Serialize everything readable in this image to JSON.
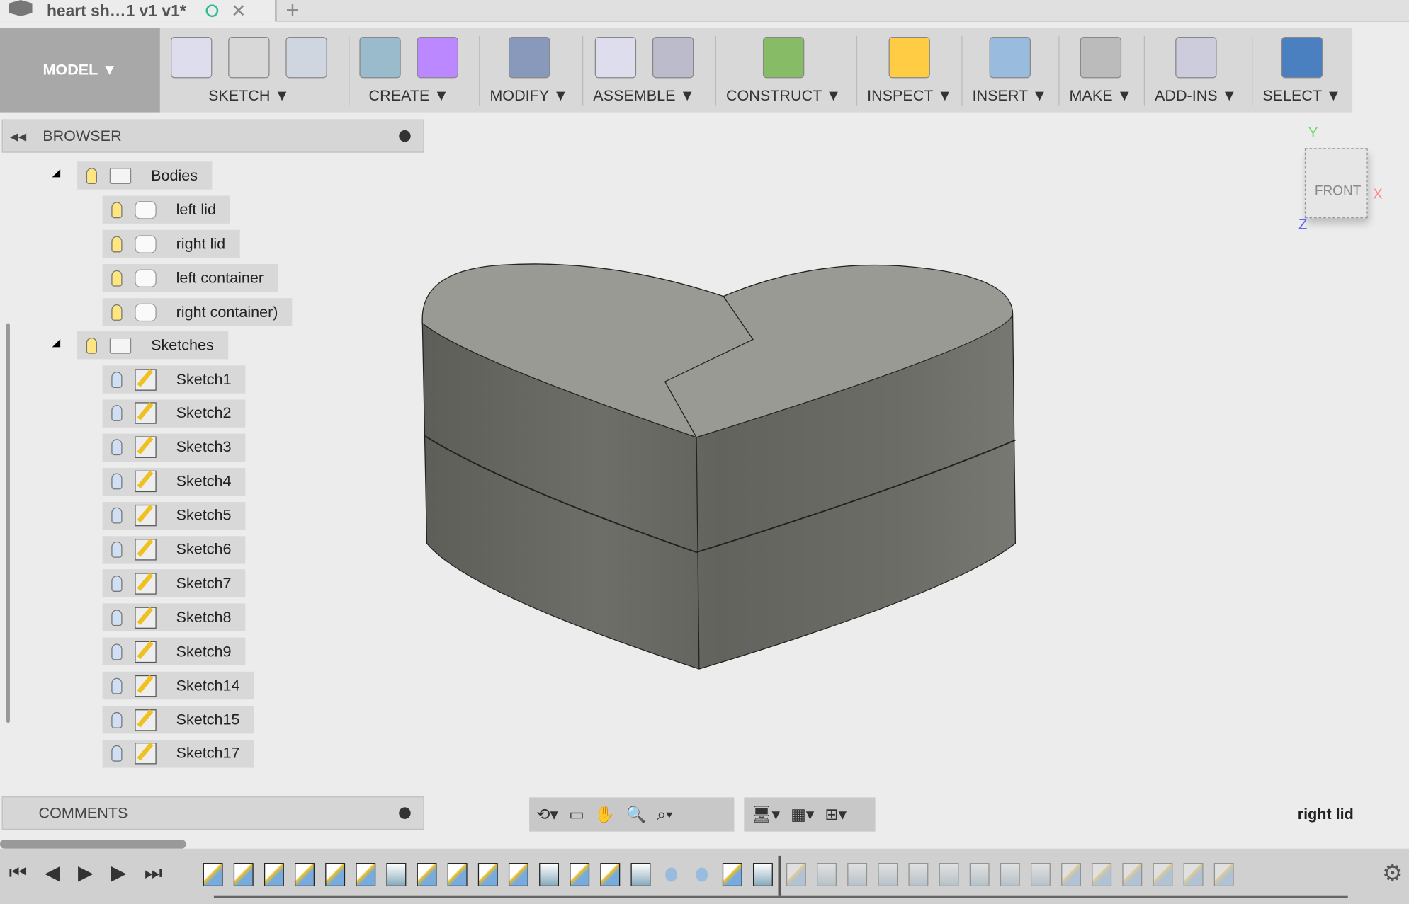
{
  "tab": {
    "title": "heart sh…1 v1 v1*",
    "close": "✕",
    "new": "+"
  },
  "toolbar": {
    "workspace": "MODEL ▼",
    "groups": [
      {
        "label": "SKETCH ▼",
        "icons": [
          "create-sketch-icon",
          "arc-icon",
          "rectangle-icon"
        ]
      },
      {
        "label": "CREATE ▼",
        "icons": [
          "extrude-icon",
          "form-icon"
        ]
      },
      {
        "label": "MODIFY ▼",
        "icons": [
          "press-pull-icon"
        ]
      },
      {
        "label": "ASSEMBLE ▼",
        "icons": [
          "new-component-icon",
          "joint-icon"
        ]
      },
      {
        "label": "CONSTRUCT ▼",
        "icons": [
          "offset-plane-icon"
        ]
      },
      {
        "label": "INSPECT ▼",
        "icons": [
          "measure-icon"
        ]
      },
      {
        "label": "INSERT ▼",
        "icons": [
          "insert-image-icon"
        ]
      },
      {
        "label": "MAKE ▼",
        "icons": [
          "3d-print-icon"
        ]
      },
      {
        "label": "ADD-INS ▼",
        "icons": [
          "scripts-icon"
        ]
      },
      {
        "label": "SELECT ▼",
        "icons": [
          "select-icon"
        ]
      }
    ]
  },
  "browser": {
    "title": "BROWSER",
    "bodies": {
      "label": "Bodies",
      "items": [
        "left lid",
        "right lid",
        "left container",
        "right container)"
      ]
    },
    "sketches": {
      "label": "Sketches",
      "items": [
        "Sketch1",
        "Sketch2",
        "Sketch3",
        "Sketch4",
        "Sketch5",
        "Sketch6",
        "Sketch7",
        "Sketch8",
        "Sketch9",
        "Sketch14",
        "Sketch15",
        "Sketch17"
      ]
    }
  },
  "comments": {
    "title": "COMMENTS"
  },
  "viewcube": {
    "face": "FRONT",
    "x": "X",
    "y": "Y",
    "z": "Z"
  },
  "status": {
    "selection": "right lid"
  },
  "timeline": {
    "items": [
      "sketch",
      "sketch",
      "sketch",
      "sketch",
      "sketch",
      "sketch",
      "extrude",
      "sketch",
      "sketch",
      "sketch",
      "sketch",
      "loft",
      "sketch",
      "sketch",
      "loft",
      "joint",
      "joint",
      "sketch",
      "loft",
      "sketch",
      "extrude",
      "extrude",
      "extrude",
      "box",
      "coil",
      "coil",
      "coil",
      "coil",
      "sketch",
      "sketch",
      "sketch",
      "sketch",
      "sketch",
      "sketch"
    ],
    "current": 19
  }
}
